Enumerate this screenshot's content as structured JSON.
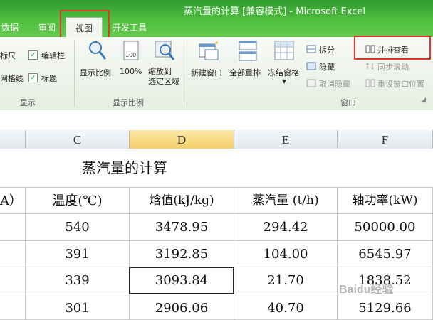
{
  "window": {
    "title": "蒸汽量的计算  [兼容模式]  -  Microsoft Excel"
  },
  "tabs": [
    {
      "label": "数据"
    },
    {
      "label": "审阅"
    },
    {
      "label": "视图",
      "active": true
    },
    {
      "label": "开发工具"
    }
  ],
  "ribbon": {
    "show_group": {
      "label": "显示",
      "items": {
        "ruler": "标尺",
        "gridlines": "网格线",
        "formula_bar": "编辑栏",
        "headings": "标题"
      }
    },
    "zoom_group": {
      "label": "显示比例",
      "buttons": {
        "zoom": "显示比例",
        "hundred": "100%",
        "zoom_to_selection": "缩放到\n选定区域"
      }
    },
    "window_group": {
      "label": "窗口",
      "buttons": {
        "new_window": "新建窗口",
        "arrange_all": "全部重排",
        "freeze_panes": "冻结窗格",
        "split": "拆分",
        "hide": "隐藏",
        "unhide": "取消隐藏",
        "view_side_by_side": "并排查看",
        "sync_scroll": "同步滚动",
        "reset_position": "重设窗口位置"
      }
    }
  },
  "grid": {
    "columns": [
      "C",
      "D",
      "E",
      "F"
    ],
    "selected_column": "D",
    "title": "蒸汽量的计算",
    "headers": [
      "A）",
      "温度(℃)",
      "焓值(kJ/kg)",
      "蒸汽量 (t/h)",
      "轴功率(kW)"
    ],
    "rows": [
      [
        "540",
        "3478.95",
        "294.42",
        "50000.00"
      ],
      [
        "391",
        "3192.85",
        "104.00",
        "6545.97"
      ],
      [
        "339",
        "3093.84",
        "21.70",
        "1838.52"
      ],
      [
        "301",
        "2906.06",
        "40.70",
        "5129.66"
      ]
    ]
  },
  "watermark": "Baidu经验"
}
